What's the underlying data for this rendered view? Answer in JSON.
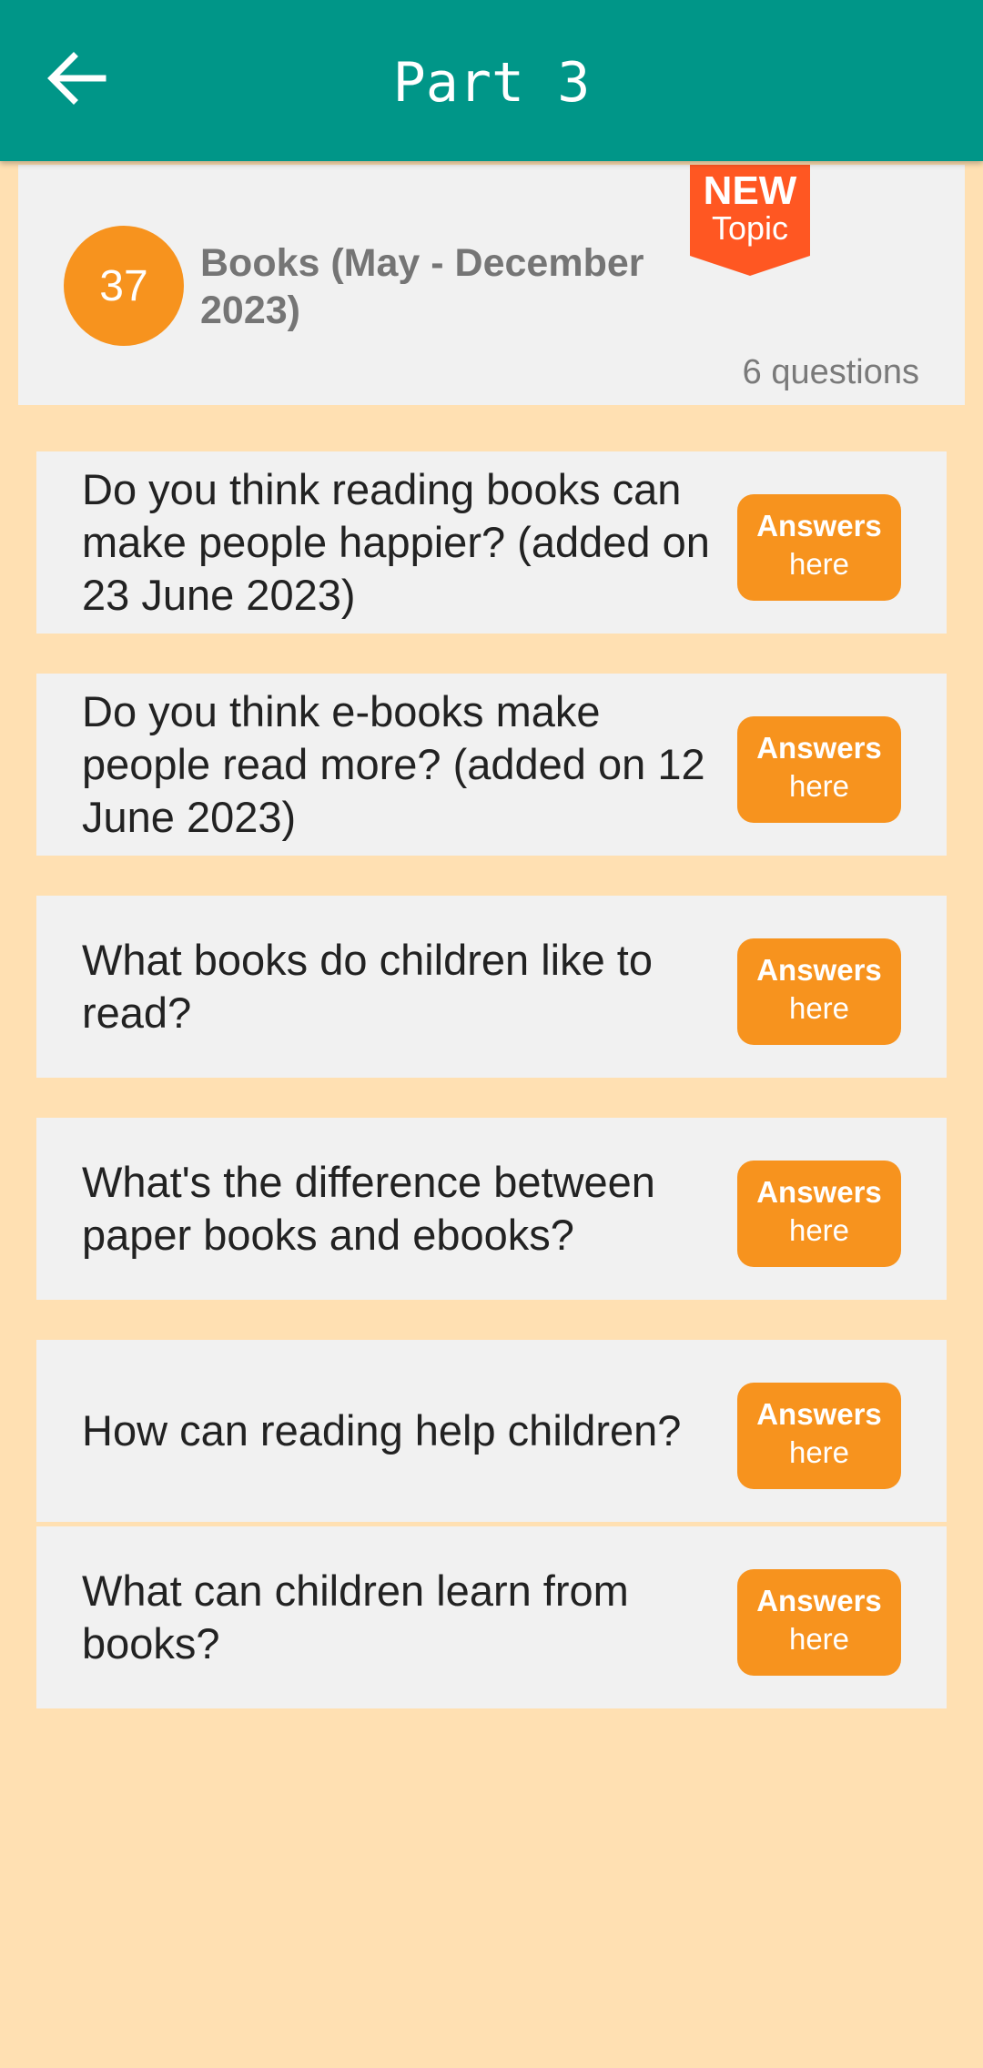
{
  "appbar": {
    "title": "Part 3",
    "back_icon": "arrow-left-icon",
    "color": "#009688"
  },
  "topic": {
    "number": "37",
    "title": "Books (May - December 2023)",
    "badge_new": "NEW",
    "badge_topic": "Topic",
    "question_count": "6 questions"
  },
  "questions": [
    {
      "text": "Do you think reading books can make people happier? (added on 23 June 2023)",
      "button_line1": "Answers",
      "button_line2": "here"
    },
    {
      "text": "Do you think e-books make people read more? (added on 12 June 2023)",
      "button_line1": "Answers",
      "button_line2": "here"
    },
    {
      "text": "What books do children like to read?",
      "button_line1": "Answers",
      "button_line2": "here"
    },
    {
      "text": "What's the difference between paper books and ebooks?",
      "button_line1": "Answers",
      "button_line2": "here"
    },
    {
      "text": "How can reading help children?",
      "button_line1": "Answers",
      "button_line2": "here"
    },
    {
      "text": "What can children learn from books?",
      "button_line1": "Answers",
      "button_line2": "here"
    }
  ],
  "colors": {
    "background": "#FFE0B2",
    "accent": "#F7931E",
    "badge": "#FF5722",
    "card": "#F1F1F1"
  }
}
